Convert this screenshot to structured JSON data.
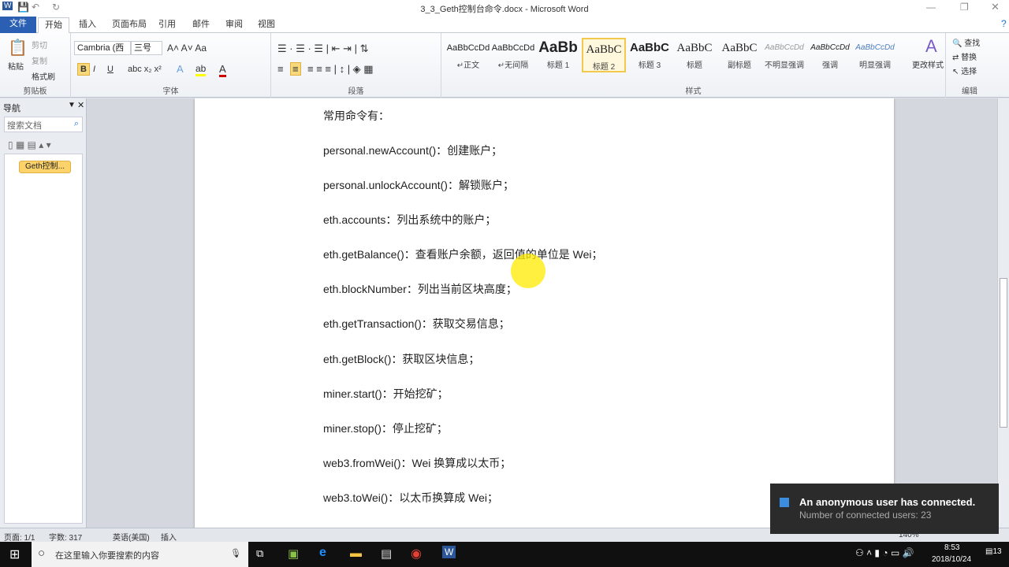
{
  "window": {
    "title": "3_3_Geth控制台命令.docx - Microsoft Word"
  },
  "tabs": [
    "文件",
    "开始",
    "插入",
    "页面布局",
    "引用",
    "邮件",
    "审阅",
    "视图"
  ],
  "ribbon": {
    "clipboard": {
      "paste": "粘贴",
      "cut": "剪切",
      "copy": "复制",
      "format_painter": "格式刷",
      "label": "剪贴板"
    },
    "font": {
      "name": "Cambria (西",
      "size": "三号",
      "label": "字体"
    },
    "paragraph": {
      "label": "段落"
    },
    "styles": {
      "items": [
        {
          "sample": "AaBbCcDd",
          "name": "↵正文"
        },
        {
          "sample": "AaBbCcDd",
          "name": "↵无间隔"
        },
        {
          "sample": "AaBb",
          "name": "标题 1"
        },
        {
          "sample": "AaBbC",
          "name": "标题 2"
        },
        {
          "sample": "AaBbC",
          "name": "标题 3"
        },
        {
          "sample": "AaBbC",
          "name": "标题"
        },
        {
          "sample": "AaBbC",
          "name": "副标题"
        },
        {
          "sample": "AaBbCcDd",
          "name": "不明显强调"
        },
        {
          "sample": "AaBbCcDd",
          "name": "强调"
        },
        {
          "sample": "AaBbCcDd",
          "name": "明显强调"
        }
      ],
      "selected": "标题 2",
      "change": "更改样式",
      "label": "样式"
    },
    "editing": {
      "find": "查找",
      "replace": "替换",
      "select": "选择",
      "label": "编辑"
    }
  },
  "nav": {
    "title": "导航",
    "search_placeholder": "搜索文档",
    "heading": "Geth控制..."
  },
  "document": {
    "lines": [
      "常用命令有：",
      "personal.newAccount()：创建账户；",
      "personal.unlockAccount()：解锁账户；",
      "eth.accounts：列出系统中的账户；",
      "eth.getBalance()：查看账户余额，返回值的单位是 Wei；",
      "eth.blockNumber：列出当前区块高度；",
      "eth.getTransaction()：获取交易信息；",
      "eth.getBlock()：获取区块信息；",
      "miner.start()：开始挖矿；",
      "miner.stop()：停止挖矿；",
      "web3.fromWei()：Wei 换算成以太币；",
      "web3.toWei()：以太币换算成 Wei；"
    ]
  },
  "status": {
    "page": "页面: 1/1",
    "words": "字数: 317",
    "lang": "英语(美国)",
    "mode": "插入",
    "zoom": "140%"
  },
  "taskbar": {
    "search_placeholder": "在这里输入你要搜索的内容",
    "time": "8:53",
    "date": "2018/10/24",
    "notifications": "13"
  },
  "toast": {
    "title": "An anonymous user has connected.",
    "body": "Number of connected users: 23"
  },
  "colors": {
    "file_tab": "#2b5fb4",
    "highlight": "#f2c94c",
    "toast_bg": "#2b2b2b"
  }
}
